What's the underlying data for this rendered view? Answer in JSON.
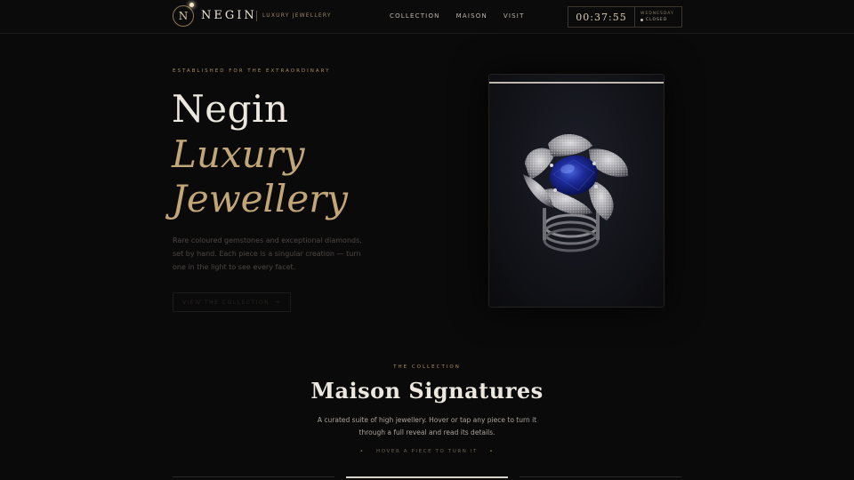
{
  "header": {
    "logo_letter": "N",
    "brand": "NEGIN",
    "tagline": "Luxury Jewellery",
    "nav": [
      "COLLECTION",
      "MAISON",
      "VISIT"
    ],
    "clock": {
      "time": "00:37:55",
      "day": "WEDNESDAY",
      "status": "CLOSED"
    }
  },
  "hero": {
    "eyebrow": "ESTABLISHED FOR THE EXTRAORDINARY",
    "title_line1": "Negin",
    "title_line2": "Luxury",
    "title_line3": "Jewellery",
    "description": "Rare coloured gemstones and exceptional diamonds, set by hand. Each piece is a singular creation — turn one in the light to see every facet.",
    "cta_label": "VIEW THE COLLECTION",
    "cta_icon": "arrow-right-icon"
  },
  "collection": {
    "eyebrow": "THE COLLECTION",
    "title": "Maison Signatures",
    "description": "A curated suite of high jewellery. Hover or tap any piece to turn it through a full reveal and read its details.",
    "hint": "HOVER A PIECE TO TURN IT"
  },
  "colors": {
    "background": "#0b0a0b",
    "gold": "#c2a678",
    "sapphire": "#1b2a8a"
  }
}
